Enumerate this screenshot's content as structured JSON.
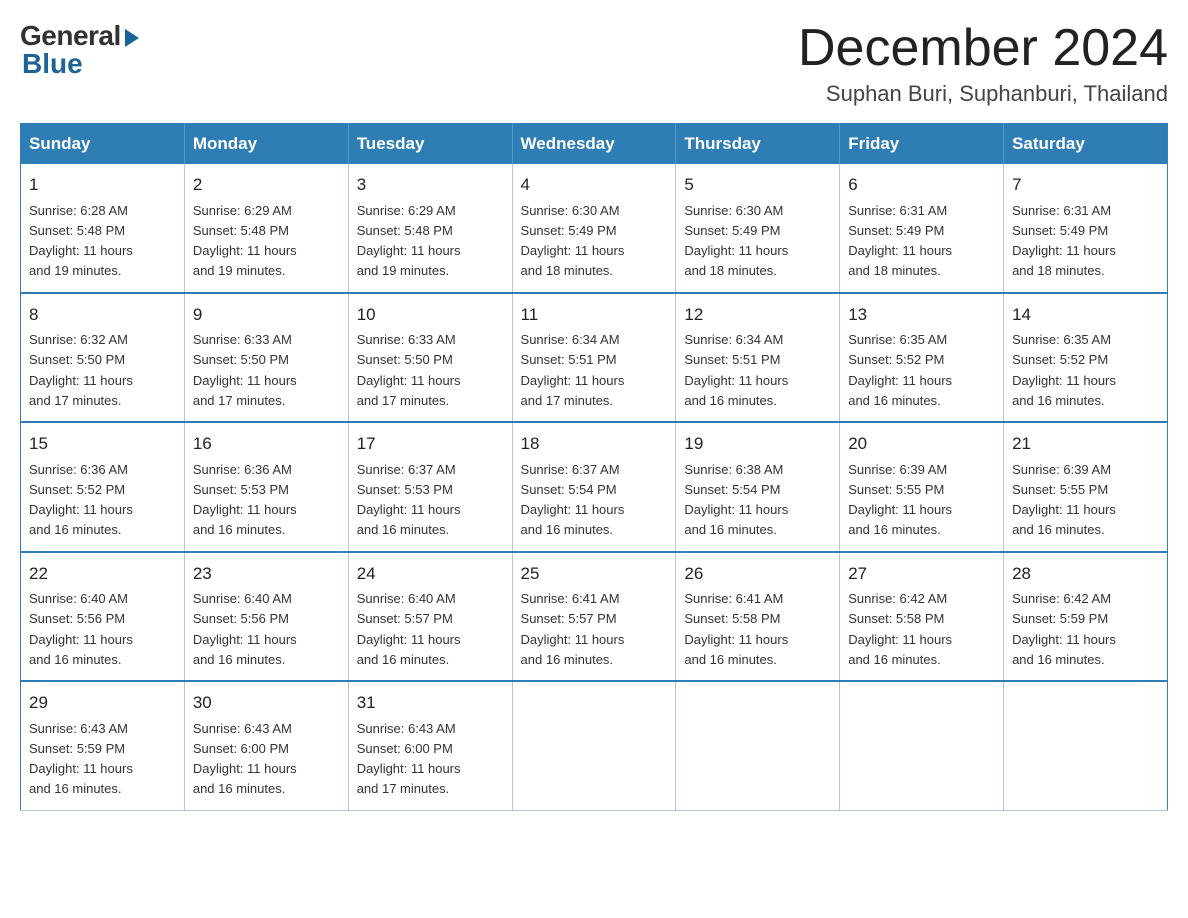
{
  "logo": {
    "general": "General",
    "blue": "Blue"
  },
  "title": {
    "month_year": "December 2024",
    "location": "Suphan Buri, Suphanburi, Thailand"
  },
  "header_days": [
    "Sunday",
    "Monday",
    "Tuesday",
    "Wednesday",
    "Thursday",
    "Friday",
    "Saturday"
  ],
  "weeks": [
    [
      {
        "day": "1",
        "info": "Sunrise: 6:28 AM\nSunset: 5:48 PM\nDaylight: 11 hours\nand 19 minutes."
      },
      {
        "day": "2",
        "info": "Sunrise: 6:29 AM\nSunset: 5:48 PM\nDaylight: 11 hours\nand 19 minutes."
      },
      {
        "day": "3",
        "info": "Sunrise: 6:29 AM\nSunset: 5:48 PM\nDaylight: 11 hours\nand 19 minutes."
      },
      {
        "day": "4",
        "info": "Sunrise: 6:30 AM\nSunset: 5:49 PM\nDaylight: 11 hours\nand 18 minutes."
      },
      {
        "day": "5",
        "info": "Sunrise: 6:30 AM\nSunset: 5:49 PM\nDaylight: 11 hours\nand 18 minutes."
      },
      {
        "day": "6",
        "info": "Sunrise: 6:31 AM\nSunset: 5:49 PM\nDaylight: 11 hours\nand 18 minutes."
      },
      {
        "day": "7",
        "info": "Sunrise: 6:31 AM\nSunset: 5:49 PM\nDaylight: 11 hours\nand 18 minutes."
      }
    ],
    [
      {
        "day": "8",
        "info": "Sunrise: 6:32 AM\nSunset: 5:50 PM\nDaylight: 11 hours\nand 17 minutes."
      },
      {
        "day": "9",
        "info": "Sunrise: 6:33 AM\nSunset: 5:50 PM\nDaylight: 11 hours\nand 17 minutes."
      },
      {
        "day": "10",
        "info": "Sunrise: 6:33 AM\nSunset: 5:50 PM\nDaylight: 11 hours\nand 17 minutes."
      },
      {
        "day": "11",
        "info": "Sunrise: 6:34 AM\nSunset: 5:51 PM\nDaylight: 11 hours\nand 17 minutes."
      },
      {
        "day": "12",
        "info": "Sunrise: 6:34 AM\nSunset: 5:51 PM\nDaylight: 11 hours\nand 16 minutes."
      },
      {
        "day": "13",
        "info": "Sunrise: 6:35 AM\nSunset: 5:52 PM\nDaylight: 11 hours\nand 16 minutes."
      },
      {
        "day": "14",
        "info": "Sunrise: 6:35 AM\nSunset: 5:52 PM\nDaylight: 11 hours\nand 16 minutes."
      }
    ],
    [
      {
        "day": "15",
        "info": "Sunrise: 6:36 AM\nSunset: 5:52 PM\nDaylight: 11 hours\nand 16 minutes."
      },
      {
        "day": "16",
        "info": "Sunrise: 6:36 AM\nSunset: 5:53 PM\nDaylight: 11 hours\nand 16 minutes."
      },
      {
        "day": "17",
        "info": "Sunrise: 6:37 AM\nSunset: 5:53 PM\nDaylight: 11 hours\nand 16 minutes."
      },
      {
        "day": "18",
        "info": "Sunrise: 6:37 AM\nSunset: 5:54 PM\nDaylight: 11 hours\nand 16 minutes."
      },
      {
        "day": "19",
        "info": "Sunrise: 6:38 AM\nSunset: 5:54 PM\nDaylight: 11 hours\nand 16 minutes."
      },
      {
        "day": "20",
        "info": "Sunrise: 6:39 AM\nSunset: 5:55 PM\nDaylight: 11 hours\nand 16 minutes."
      },
      {
        "day": "21",
        "info": "Sunrise: 6:39 AM\nSunset: 5:55 PM\nDaylight: 11 hours\nand 16 minutes."
      }
    ],
    [
      {
        "day": "22",
        "info": "Sunrise: 6:40 AM\nSunset: 5:56 PM\nDaylight: 11 hours\nand 16 minutes."
      },
      {
        "day": "23",
        "info": "Sunrise: 6:40 AM\nSunset: 5:56 PM\nDaylight: 11 hours\nand 16 minutes."
      },
      {
        "day": "24",
        "info": "Sunrise: 6:40 AM\nSunset: 5:57 PM\nDaylight: 11 hours\nand 16 minutes."
      },
      {
        "day": "25",
        "info": "Sunrise: 6:41 AM\nSunset: 5:57 PM\nDaylight: 11 hours\nand 16 minutes."
      },
      {
        "day": "26",
        "info": "Sunrise: 6:41 AM\nSunset: 5:58 PM\nDaylight: 11 hours\nand 16 minutes."
      },
      {
        "day": "27",
        "info": "Sunrise: 6:42 AM\nSunset: 5:58 PM\nDaylight: 11 hours\nand 16 minutes."
      },
      {
        "day": "28",
        "info": "Sunrise: 6:42 AM\nSunset: 5:59 PM\nDaylight: 11 hours\nand 16 minutes."
      }
    ],
    [
      {
        "day": "29",
        "info": "Sunrise: 6:43 AM\nSunset: 5:59 PM\nDaylight: 11 hours\nand 16 minutes."
      },
      {
        "day": "30",
        "info": "Sunrise: 6:43 AM\nSunset: 6:00 PM\nDaylight: 11 hours\nand 16 minutes."
      },
      {
        "day": "31",
        "info": "Sunrise: 6:43 AM\nSunset: 6:00 PM\nDaylight: 11 hours\nand 17 minutes."
      },
      {
        "day": "",
        "info": ""
      },
      {
        "day": "",
        "info": ""
      },
      {
        "day": "",
        "info": ""
      },
      {
        "day": "",
        "info": ""
      }
    ]
  ]
}
